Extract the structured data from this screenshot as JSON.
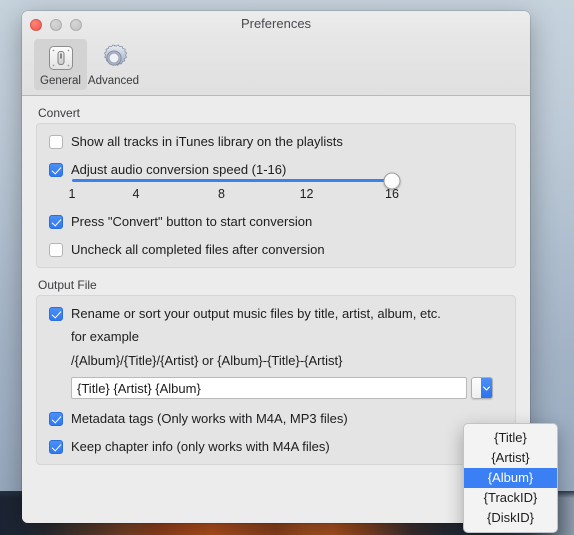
{
  "window": {
    "title": "Preferences",
    "traffic_lights": [
      "close-button",
      "minimize-button",
      "maximize-button"
    ]
  },
  "toolbar": {
    "tabs": [
      {
        "label": "General",
        "icon": "general-switch-icon",
        "selected": true
      },
      {
        "label": "Advanced",
        "icon": "gear-icon",
        "selected": false
      }
    ]
  },
  "convert": {
    "group_label": "Convert",
    "show_all_tracks": {
      "label": "Show all tracks in iTunes library on the playlists",
      "checked": false
    },
    "adjust_speed": {
      "label": "Adjust audio conversion speed (1-16)",
      "checked": true
    },
    "slider": {
      "value": 16,
      "min": 1,
      "max": 16,
      "ticks": [
        "1",
        "4",
        "8",
        "12",
        "16"
      ],
      "tick_positions": [
        0,
        20,
        46.7,
        73.3,
        100
      ]
    },
    "press_convert": {
      "label": "Press \"Convert\" button to start conversion",
      "checked": true
    },
    "uncheck_completed": {
      "label": "Uncheck all completed files after conversion",
      "checked": false
    }
  },
  "output_file": {
    "group_label": "Output File",
    "rename_or_sort": {
      "label": "Rename or sort your output music files by title, artist, album, etc.",
      "checked": true
    },
    "example_heading": "for example",
    "example_pattern": "/{Album}/{Title}/{Artist} or {Album}-{Title}-{Artist}",
    "pattern_field": {
      "value": "{Title} {Artist} {Album}",
      "placeholder": ""
    },
    "metadata_tags": {
      "label": "Metadata tags (Only works with M4A, MP3 files)",
      "checked": true
    },
    "keep_chapter_info": {
      "label": "Keep chapter info (only works with  M4A files)",
      "checked": true
    }
  },
  "dropdown": {
    "open": true,
    "items": [
      {
        "label": "{Title}",
        "selected": false
      },
      {
        "label": "{Artist}",
        "selected": false
      },
      {
        "label": "{Album}",
        "selected": true
      },
      {
        "label": "{TrackID}",
        "selected": false
      },
      {
        "label": "{DiskID}",
        "selected": false
      }
    ]
  },
  "colors": {
    "accent_blue": "#3b7ff5",
    "slider_blue": "#3b82f0",
    "window_bg": "#ececec",
    "group_bg": "#e4e4e4",
    "close_red": "#f2544a"
  }
}
